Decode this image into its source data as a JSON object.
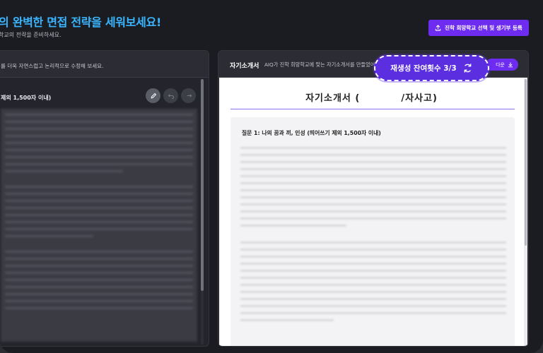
{
  "header": {
    "headline_prefix": "의 ",
    "headline_accent": "완벽한 면접 전략을 세워보세요!",
    "subline": "학교의 전략을 준비하세요.",
    "cta_label": "진학 희망학교 선택 및 생기부 등록",
    "cta_icon": "upload-icon"
  },
  "left_panel": {
    "hint": "를 더욱 자연스럽고 논리적으로 수정해 보세요.",
    "question": "제외 1,500자 이내)",
    "tools": [
      "edit-icon",
      "undo-icon",
      "redo-icon"
    ]
  },
  "right_panel": {
    "title": "자기소개서",
    "description": "AIQ가 진학 희망학교에 맞는 자기소개서를 만들었어요",
    "download_label": "다운",
    "download_icon": "download-icon",
    "doc_title_left": "자기소개서 (",
    "doc_title_right": "/자사고)",
    "question": "질문 1: 나의 꿈과 끼, 인성 (띄어쓰기 제외 1,500자 이내)"
  },
  "regen": {
    "label": "재생성 잔여횟수 3/3",
    "icon": "refresh-icon"
  },
  "colors": {
    "accent": "#6d2cf0",
    "headline": "#39b6ff",
    "regen_bg": "#5b2fe0",
    "background": "#1b1c22"
  }
}
